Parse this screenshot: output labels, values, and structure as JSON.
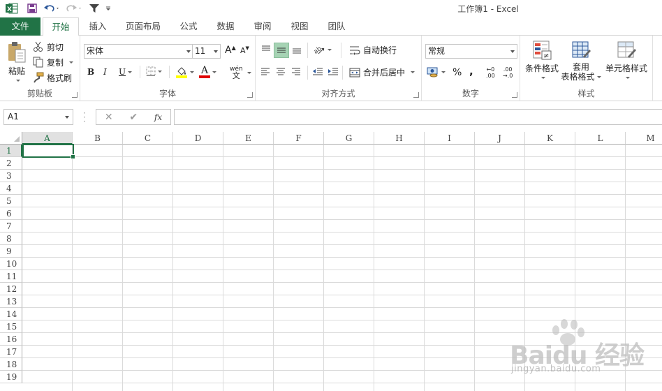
{
  "window": {
    "title": "工作簿1 - Excel"
  },
  "qat": {
    "customize_label": "⌄"
  },
  "tabs": [
    {
      "label": "文件"
    },
    {
      "label": "开始"
    },
    {
      "label": "插入"
    },
    {
      "label": "页面布局"
    },
    {
      "label": "公式"
    },
    {
      "label": "数据"
    },
    {
      "label": "审阅"
    },
    {
      "label": "视图"
    },
    {
      "label": "团队"
    }
  ],
  "ribbon": {
    "clipboard": {
      "label": "剪贴板",
      "paste": "粘贴",
      "cut": "剪切",
      "copy": "复制",
      "format_painter": "格式刷"
    },
    "font": {
      "label": "字体",
      "font_name": "宋体",
      "font_size": "11",
      "bold": "B",
      "italic": "I",
      "underline": "U",
      "grow": "A",
      "shrink": "A",
      "phonetic_top": "wén",
      "phonetic_bottom": "文",
      "font_color_glyph": "A"
    },
    "alignment": {
      "label": "对齐方式",
      "wrap_text": "自动换行",
      "merge_center": "合并后居中"
    },
    "number": {
      "label": "数字",
      "format": "常规",
      "percent": "%",
      "comma": ",",
      "inc_top": "←0",
      "inc_bottom": ".00",
      "dec_top": ".00",
      "dec_bottom": "→.0"
    },
    "styles": {
      "label": "样式",
      "conditional": "条件格式",
      "table_line1": "套用",
      "table_line2": "表格格式",
      "cell_styles": "单元格样式"
    }
  },
  "formula_bar": {
    "name_box": "A1",
    "cancel": "✕",
    "enter": "✔",
    "fx": "fx",
    "value": ""
  },
  "sheet": {
    "columns": [
      "A",
      "B",
      "C",
      "D",
      "E",
      "F",
      "G",
      "H",
      "I",
      "J",
      "K",
      "L",
      "M"
    ],
    "rows": [
      "1",
      "2",
      "3",
      "4",
      "5",
      "6",
      "7",
      "8",
      "9",
      "10",
      "11",
      "12",
      "13",
      "14",
      "15",
      "16",
      "17",
      "18",
      "19"
    ],
    "active_cell": "A1"
  },
  "colors": {
    "accent": "#217346",
    "highlight": "#ffff00",
    "font_red": "#e00000"
  }
}
